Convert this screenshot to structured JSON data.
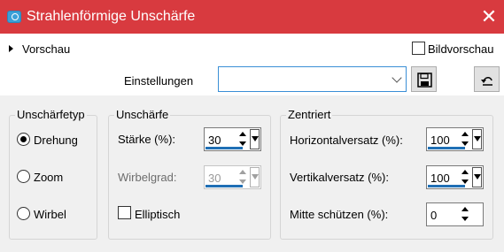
{
  "window": {
    "title": "Strahlenförmige Unschärfe",
    "close_glyph": "✕",
    "accent_color": "#d83a3f"
  },
  "preview": {
    "toggle_label": "Vorschau",
    "bildvorschau_label": "Bildvorschau",
    "bildvorschau_checked": false
  },
  "settings": {
    "label": "Einstellungen",
    "selected_value": ""
  },
  "blur_type": {
    "title": "Unschärfetyp",
    "options": [
      {
        "label": "Drehung",
        "checked": true
      },
      {
        "label": "Zoom",
        "checked": false
      },
      {
        "label": "Wirbel",
        "checked": false
      }
    ]
  },
  "blur": {
    "title": "Unschärfe",
    "strength_label": "Stärke (%):",
    "strength_value": "30",
    "swirl_label": "Wirbelgrad:",
    "swirl_value": "30",
    "swirl_enabled": false,
    "elliptic_label": "Elliptisch",
    "elliptic_checked": false
  },
  "center": {
    "title": "Zentriert",
    "h_offset_label": "Horizontalversatz (%):",
    "h_offset_value": "100",
    "v_offset_label": "Vertikalversatz (%):",
    "v_offset_value": "100",
    "protect_label": "Mitte schützen (%):",
    "protect_value": "0"
  }
}
